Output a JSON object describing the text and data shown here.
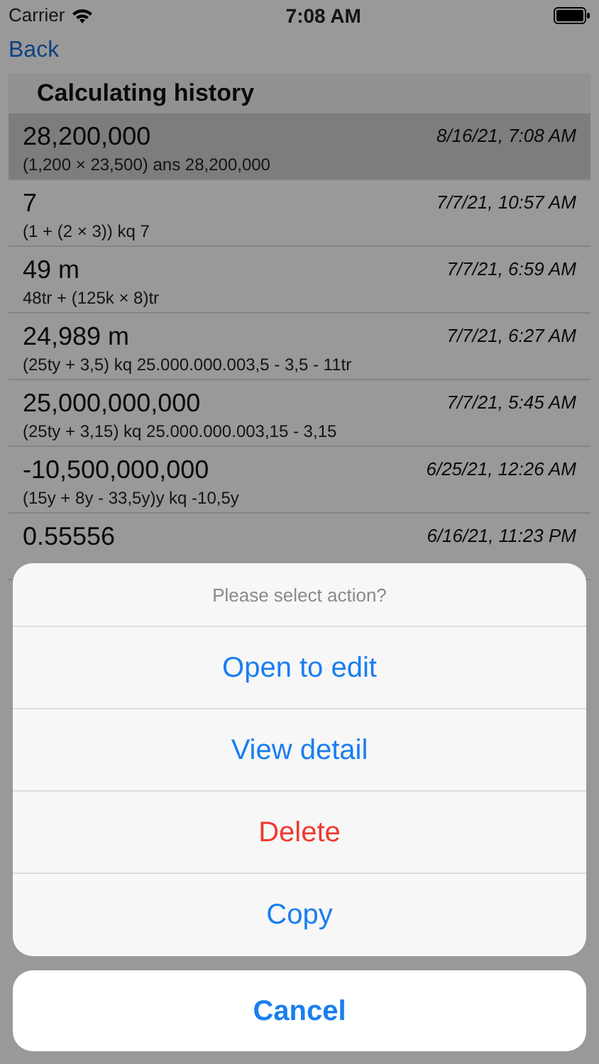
{
  "status_bar": {
    "carrier": "Carrier",
    "time": "7:08 AM"
  },
  "nav": {
    "back": "Back"
  },
  "section_title": "Calculating history",
  "rows": [
    {
      "value": "28,200,000",
      "expression": "(1,200 × 23,500) ans 28,200,000",
      "date": "8/16/21, 7:08 AM",
      "selected": true
    },
    {
      "value": "7",
      "expression": "(1 + (2 × 3)) kq 7",
      "date": "7/7/21, 10:57 AM",
      "selected": false
    },
    {
      "value": "49 m",
      "expression": "48tr + (125k × 8)tr",
      "date": "7/7/21, 6:59 AM",
      "selected": false
    },
    {
      "value": "24,989 m",
      "expression": "(25ty + 3,5) kq 25.000.000.003,5 - 3,5 - 11tr",
      "date": "7/7/21, 6:27 AM",
      "selected": false
    },
    {
      "value": "25,000,000,000",
      "expression": "(25ty + 3,15) kq 25.000.000.003,15 - 3,15",
      "date": "7/7/21, 5:45 AM",
      "selected": false
    },
    {
      "value": "-10,500,000,000",
      "expression": "(15y + 8y - 33,5y)y kq -10,5y",
      "date": "6/25/21, 12:26 AM",
      "selected": false
    },
    {
      "value": "0.55556",
      "date": "6/16/21, 11:23 PM",
      "selected": false
    }
  ],
  "action_sheet": {
    "title": "Please select action?",
    "actions": [
      {
        "label": "Open to edit",
        "kind": "default"
      },
      {
        "label": "View detail",
        "kind": "default"
      },
      {
        "label": "Delete",
        "kind": "destructive"
      },
      {
        "label": "Copy",
        "kind": "default"
      }
    ],
    "cancel": "Cancel"
  }
}
